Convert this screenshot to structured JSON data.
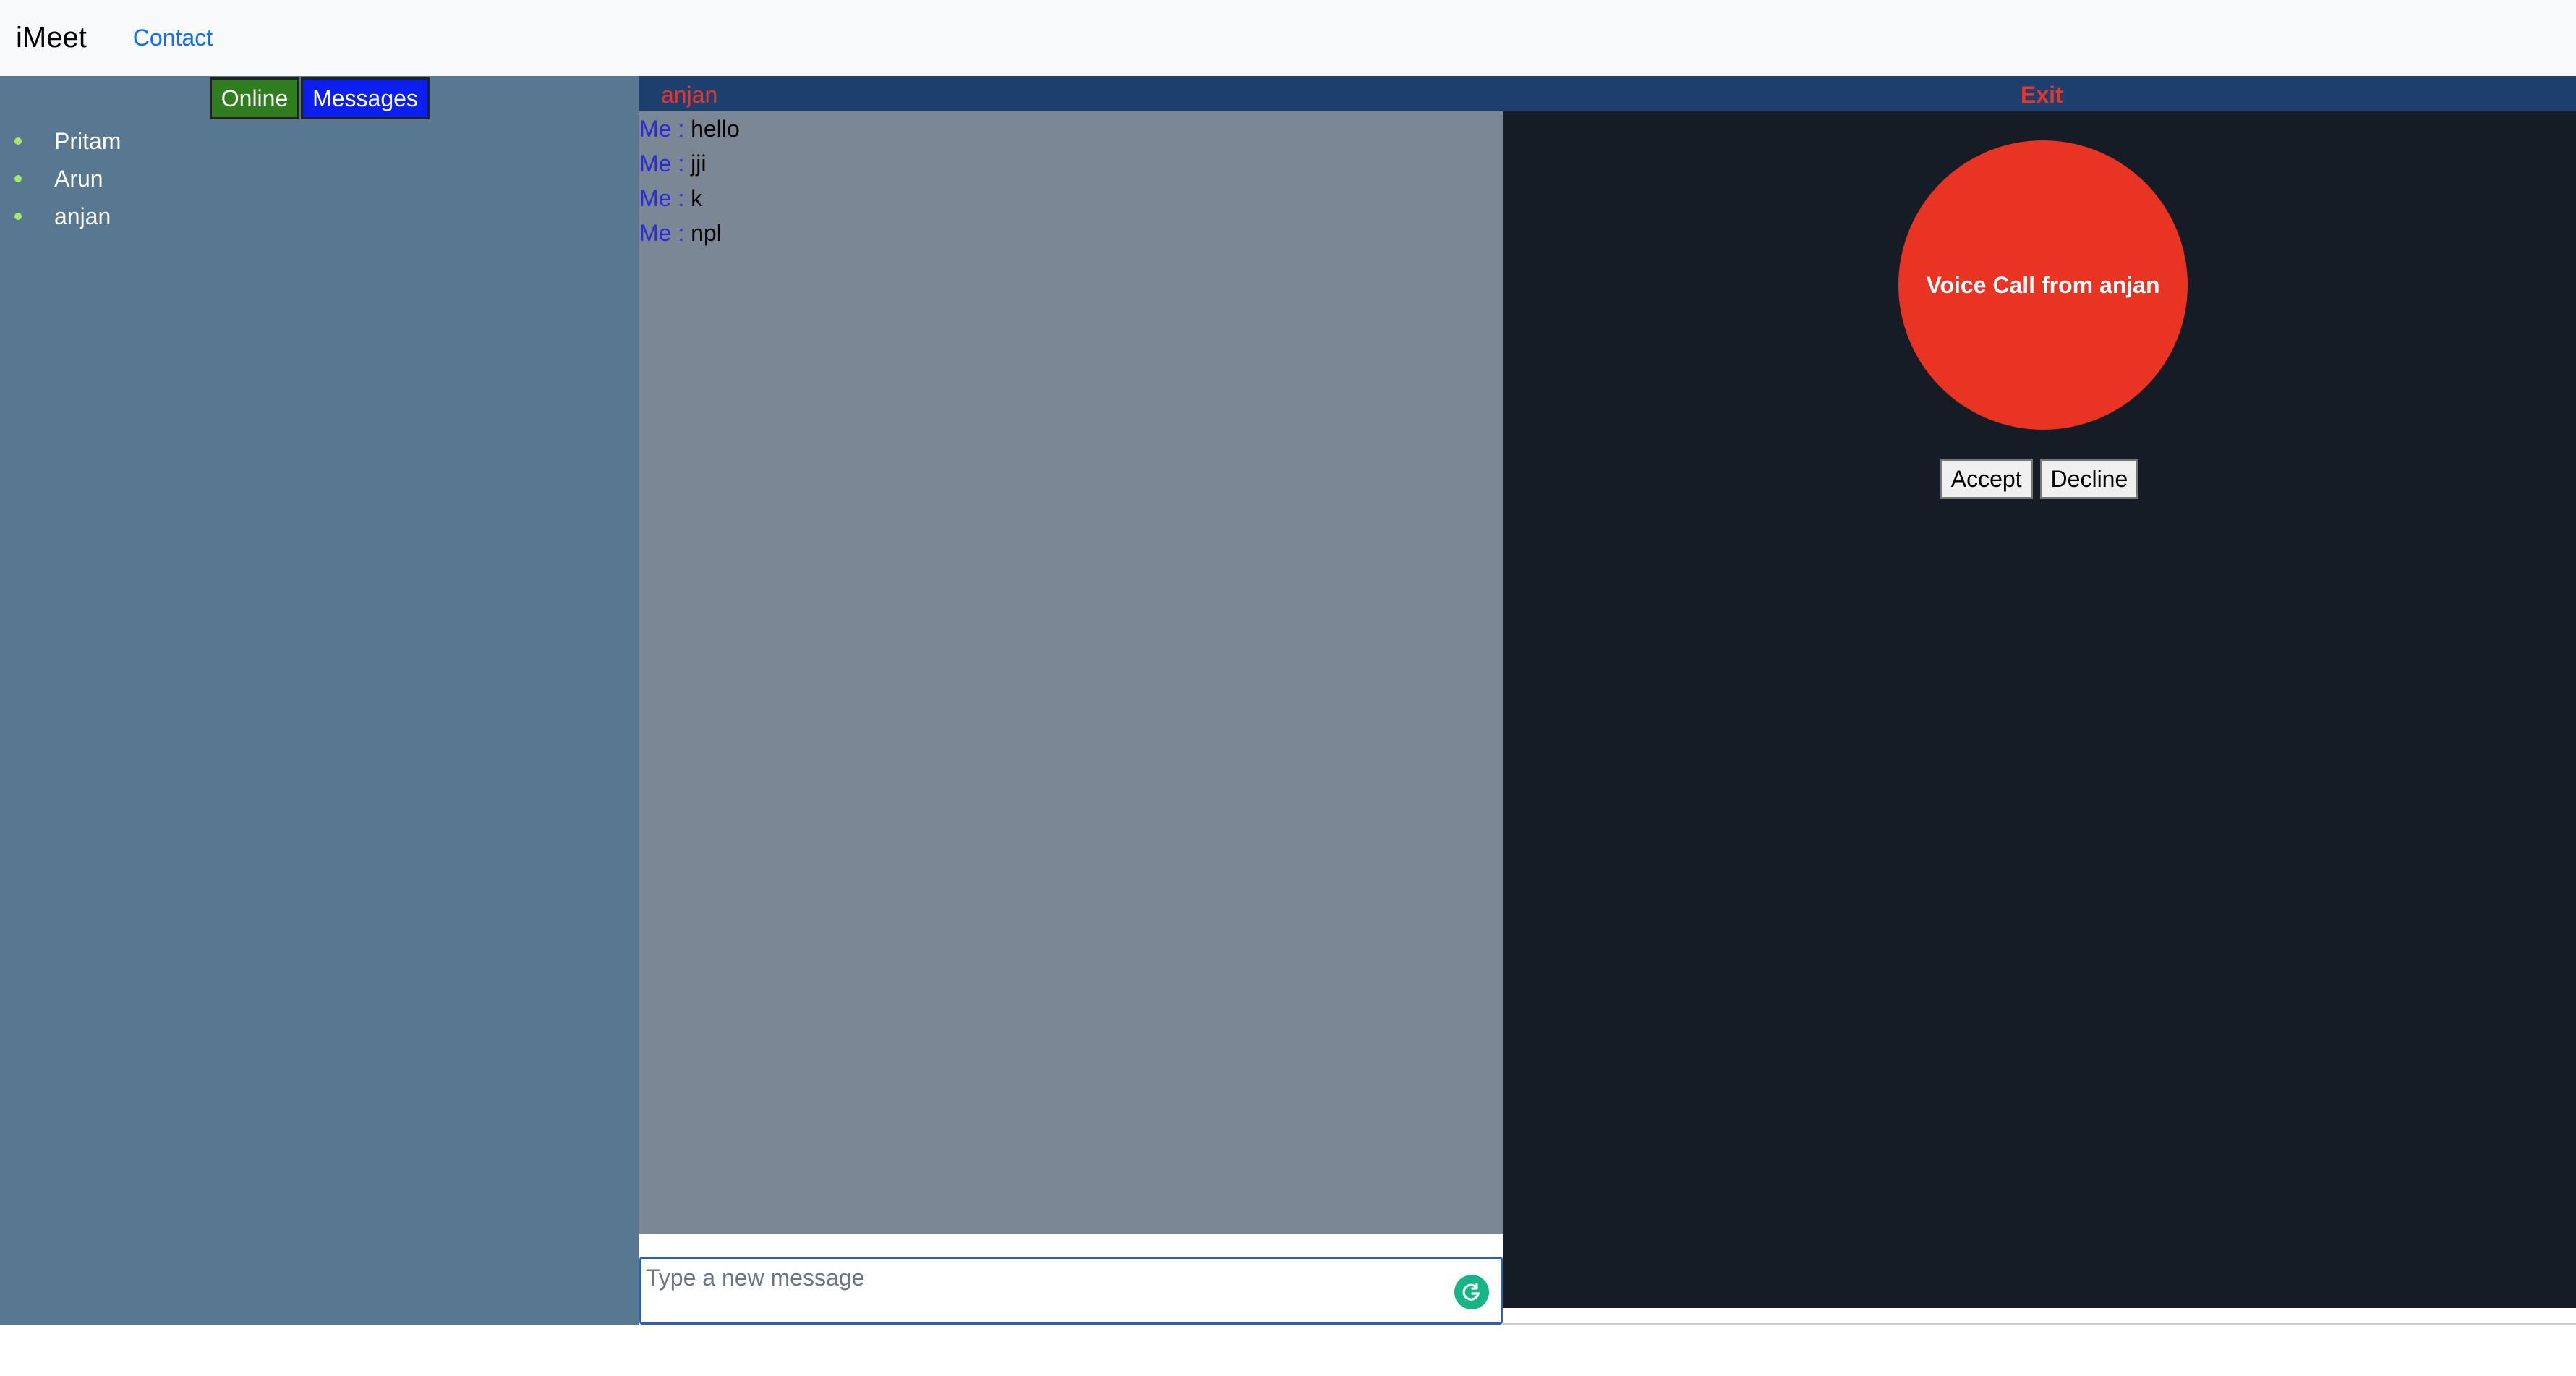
{
  "navbar": {
    "brand": "iMeet",
    "contact_link": "Contact"
  },
  "sidebar": {
    "tabs": {
      "online": "Online",
      "messages": "Messages"
    },
    "users": [
      "Pritam",
      "Arun",
      "anjan"
    ]
  },
  "chat": {
    "contact_name": "anjan",
    "exit_label": "Exit",
    "messages": [
      {
        "sender": "Me :",
        "text": "hello"
      },
      {
        "sender": "Me :",
        "text": "jji"
      },
      {
        "sender": "Me :",
        "text": "k"
      },
      {
        "sender": "Me :",
        "text": "npl"
      }
    ],
    "composer_placeholder": "Type a new message"
  },
  "call": {
    "incoming_text": "Voice Call from anjan",
    "accept_label": "Accept",
    "decline_label": "Decline"
  },
  "colors": {
    "sidebar_bg": "#587790",
    "chat_bg": "#7b8795",
    "call_panel_bg": "#161c25",
    "call_circle": "#e93323",
    "online_tab": "#2f7d1e",
    "messages_tab": "#0b1ff0",
    "header_bar": "#1c3f6d"
  },
  "icons": {
    "composer_assist": "grammarly-icon",
    "online_indicator": "online-dot-icon"
  }
}
